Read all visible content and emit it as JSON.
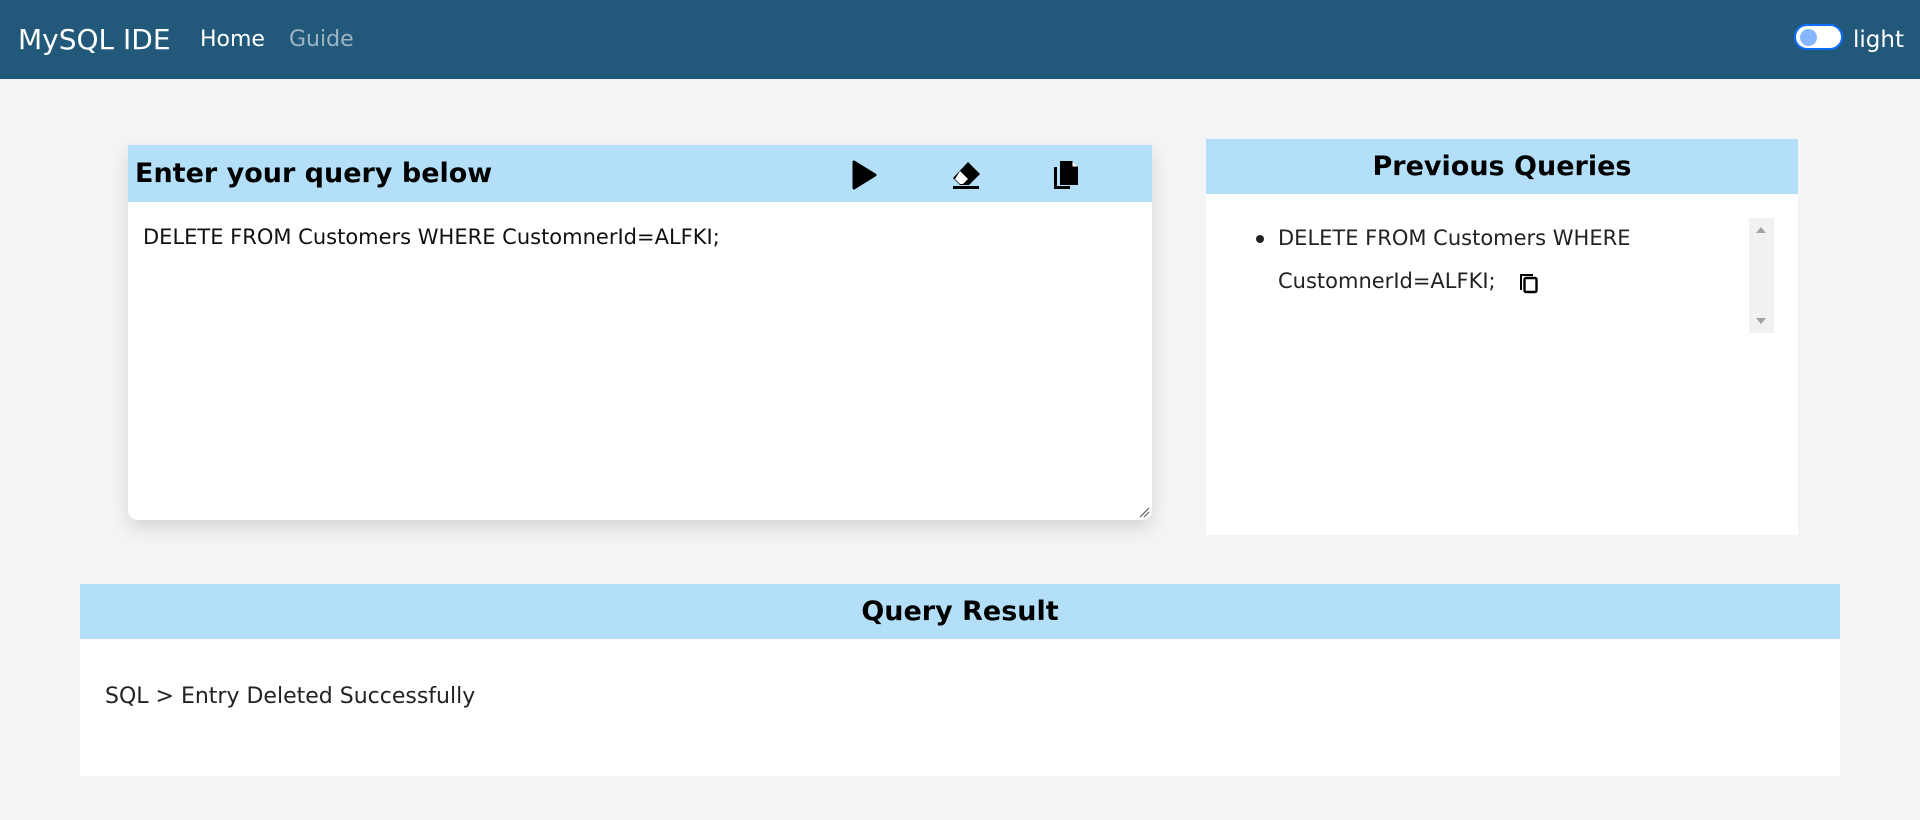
{
  "navbar": {
    "brand": "MySQL IDE",
    "links": [
      {
        "label": "Home",
        "active": true
      },
      {
        "label": "Guide",
        "active": false
      }
    ],
    "theme_label": "light",
    "colors": {
      "background": "#22597b",
      "toggle_accent": "#0d6efd"
    }
  },
  "editor": {
    "title": "Enter your query below",
    "buttons": [
      {
        "icon": "play-icon",
        "action": "run"
      },
      {
        "icon": "eraser-icon",
        "action": "clear"
      },
      {
        "icon": "copy-icon",
        "action": "copy"
      }
    ],
    "query": "DELETE FROM Customers WHERE CustomnerId=ALFKI;",
    "header_color": "#b3e0f8"
  },
  "previous_queries": {
    "title": "Previous Queries",
    "items": [
      {
        "line1": "DELETE FROM Customers WHERE",
        "line2": "CustomnerId=ALFKI;",
        "icon": "copy-icon"
      }
    ]
  },
  "result": {
    "title": "Query Result",
    "output": "SQL > Entry Deleted Successfully"
  }
}
